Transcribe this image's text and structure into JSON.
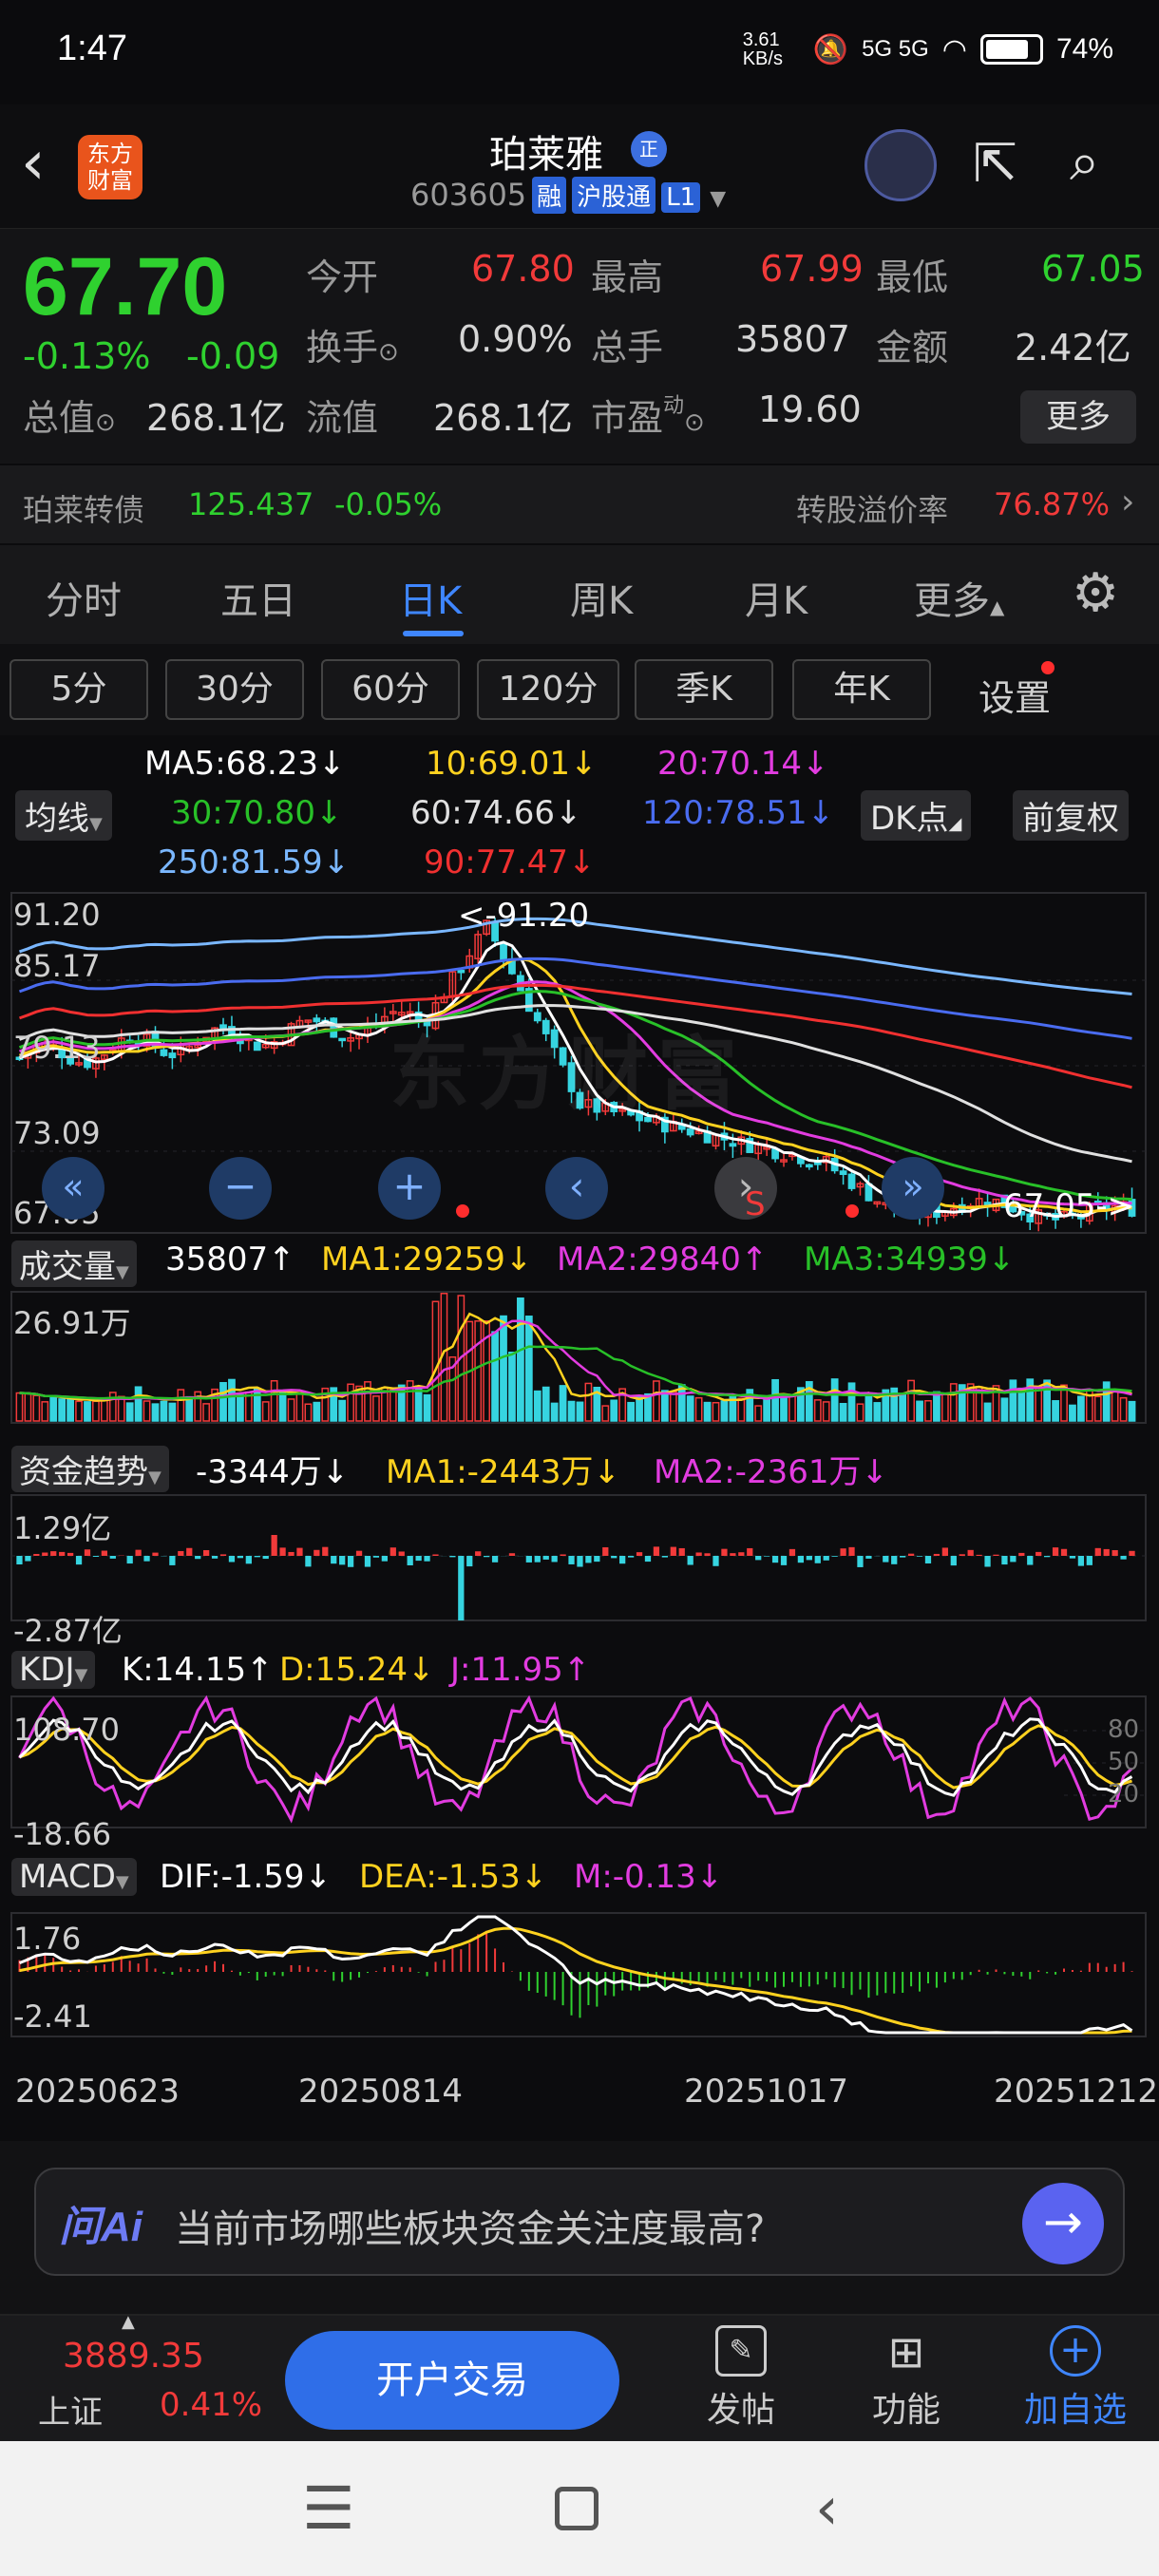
{
  "status": {
    "time": "1:47",
    "net_speed": "3.61 KB/s",
    "signal": "5G 5G",
    "battery": "74%"
  },
  "header": {
    "logo_text": "东方财富",
    "stock_name": "珀莱雅",
    "badge": "正",
    "code": "603605",
    "tags": [
      "融",
      "沪股通",
      "L1"
    ]
  },
  "quote": {
    "price": "67.70",
    "change_pct": "-0.13%",
    "change": "-0.09",
    "cells": [
      {
        "label": "今开",
        "value": "67.80",
        "color": "up"
      },
      {
        "label": "最高",
        "value": "67.99",
        "color": "up"
      },
      {
        "label": "最低",
        "value": "67.05",
        "color": "dn"
      },
      {
        "label": "换手",
        "value": "0.90%",
        "color": ""
      },
      {
        "label": "总手",
        "value": "35807",
        "color": ""
      },
      {
        "label": "金额",
        "value": "2.42亿",
        "color": ""
      },
      {
        "label": "总值",
        "value": "268.1亿",
        "color": ""
      },
      {
        "label": "流值",
        "value": "268.1亿",
        "color": ""
      },
      {
        "label": "市盈",
        "value": "19.60",
        "color": ""
      }
    ],
    "more_label": "更多"
  },
  "convertible": {
    "label": "珀莱转债",
    "price": "125.437",
    "change": "-0.05%",
    "premium_label": "转股溢价率",
    "premium": "76.87%"
  },
  "tabs": [
    "分时",
    "五日",
    "日K",
    "周K",
    "月K",
    "更多"
  ],
  "active_tab": "日K",
  "periods": [
    "5分",
    "30分",
    "60分",
    "120分",
    "季K",
    "年K"
  ],
  "settings_label": "设置",
  "legend_ma": {
    "junxian": "均线",
    "ma5": "MA5:68.23",
    "ma10": "10:69.01",
    "ma20": "20:70.14",
    "ma30": "30:70.80",
    "ma60": "60:74.66",
    "ma120": "120:78.51",
    "ma250": "250:81.59",
    "ma90": "90:77.47",
    "dk": "DK点",
    "fq": "前复权"
  },
  "price_axis": [
    "91.20",
    "85.17",
    "79.13",
    "73.09",
    "67.05"
  ],
  "markers": {
    "high": "<-91.20",
    "low": "67.05->",
    "sell": "S"
  },
  "watermark": "东方财富",
  "volume": {
    "label": "成交量",
    "v": "35807",
    "ma1": "MA1:29259",
    "ma2": "MA2:29840",
    "ma3": "MA3:34939",
    "axis_top": "26.91万"
  },
  "fund": {
    "label": "资金趋势",
    "v": "-3344万",
    "ma1": "MA1:-2443万",
    "ma2": "MA2:-2361万",
    "axis_top": "1.29亿",
    "axis_bot": "-2.87亿"
  },
  "kdj": {
    "label": "KDJ",
    "k": "K:14.15",
    "d": "D:15.24",
    "j": "J:11.95",
    "axis_top": "108.70",
    "axis_bot": "-18.66",
    "levels": [
      "80",
      "50",
      "20"
    ]
  },
  "macd": {
    "label": "MACD",
    "dif": "DIF:-1.59",
    "dea": "DEA:-1.53",
    "m": "M:-0.13",
    "axis_top": "1.76",
    "axis_bot": "-2.41"
  },
  "dates": [
    "20250623",
    "20250814",
    "20251017",
    "20251212"
  ],
  "ai": {
    "logo": "问Ai",
    "prompt": "当前市场哪些板块资金关注度最高?"
  },
  "bottom": {
    "index_value": "3889.35",
    "index_name": "上证",
    "index_pct": "0.41%",
    "open_label": "开户交易",
    "post_label": "发帖",
    "func_label": "功能",
    "add_label": "加自选"
  },
  "colors": {
    "up": "#f23a3a",
    "down": "#2fd12f",
    "accent": "#3f86ff",
    "ma5": "#ffffff",
    "ma10": "#ffd21f",
    "ma20": "#e23ce0",
    "ma30": "#28c028",
    "ma60": "#e0e0e0",
    "ma120": "#4a6cf0",
    "ma250": "#7ab7ff",
    "ma90": "#f03030"
  }
}
